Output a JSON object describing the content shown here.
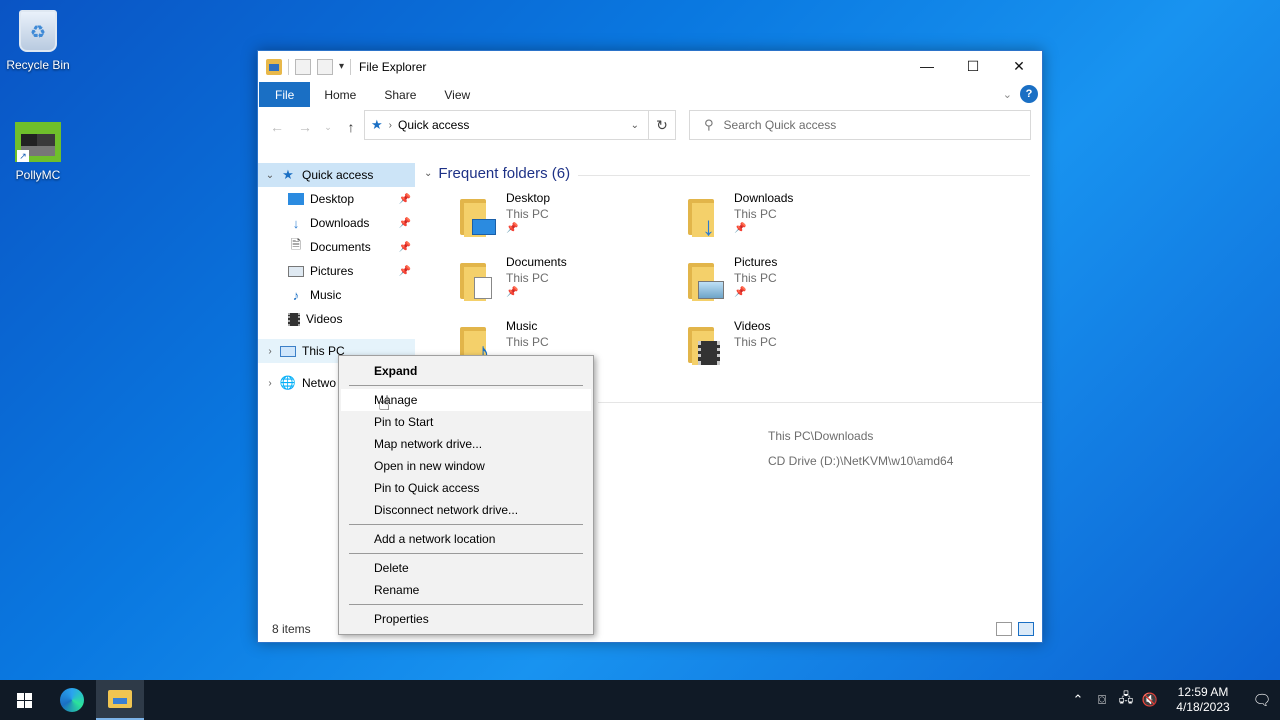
{
  "desktop": {
    "icons": [
      {
        "label": "Recycle Bin"
      },
      {
        "label": "PollyMC"
      }
    ]
  },
  "window": {
    "title": "File Explorer",
    "controls": {
      "minimize": "—",
      "maximize": "☐",
      "close": "✕"
    },
    "ribbon_tabs": [
      "File",
      "Home",
      "Share",
      "View"
    ],
    "help_label": "?",
    "address": {
      "location": "Quick access"
    },
    "search": {
      "placeholder": "Search Quick access"
    },
    "nav_pane": {
      "quick_access": "Quick access",
      "items": [
        {
          "label": "Desktop",
          "pinned": true
        },
        {
          "label": "Downloads",
          "pinned": true
        },
        {
          "label": "Documents",
          "pinned": true
        },
        {
          "label": "Pictures",
          "pinned": true
        },
        {
          "label": "Music",
          "pinned": false
        },
        {
          "label": "Videos",
          "pinned": false
        }
      ],
      "this_pc": "This PC",
      "network": "Netwo"
    },
    "frequent": {
      "header": "Frequent folders (6)",
      "folders": [
        {
          "name": "Desktop",
          "location": "This PC",
          "pinned": true
        },
        {
          "name": "Downloads",
          "location": "This PC",
          "pinned": true
        },
        {
          "name": "Documents",
          "location": "This PC",
          "pinned": true
        },
        {
          "name": "Pictures",
          "location": "This PC",
          "pinned": true
        },
        {
          "name": "Music",
          "location": "This PC",
          "pinned": false
        },
        {
          "name": "Videos",
          "location": "This PC",
          "pinned": false
        }
      ]
    },
    "recent_locations": [
      "This PC\\Downloads",
      "CD Drive (D:)\\NetKVM\\w10\\amd64"
    ],
    "status": {
      "item_count": "8 items"
    }
  },
  "context_menu": {
    "items": [
      {
        "label": "Expand",
        "bold": true
      },
      {
        "label": "Manage"
      },
      {
        "label": "Pin to Start"
      },
      {
        "label": "Map network drive..."
      },
      {
        "label": "Open in new window"
      },
      {
        "label": "Pin to Quick access"
      },
      {
        "label": "Disconnect network drive..."
      },
      {
        "label": "Add a network location"
      },
      {
        "label": "Delete"
      },
      {
        "label": "Rename"
      },
      {
        "label": "Properties"
      }
    ]
  },
  "taskbar": {
    "clock_time": "12:59 AM",
    "clock_date": "4/18/2023",
    "colors": {
      "background": "#101a26",
      "accent": "#1a6fc4"
    }
  }
}
